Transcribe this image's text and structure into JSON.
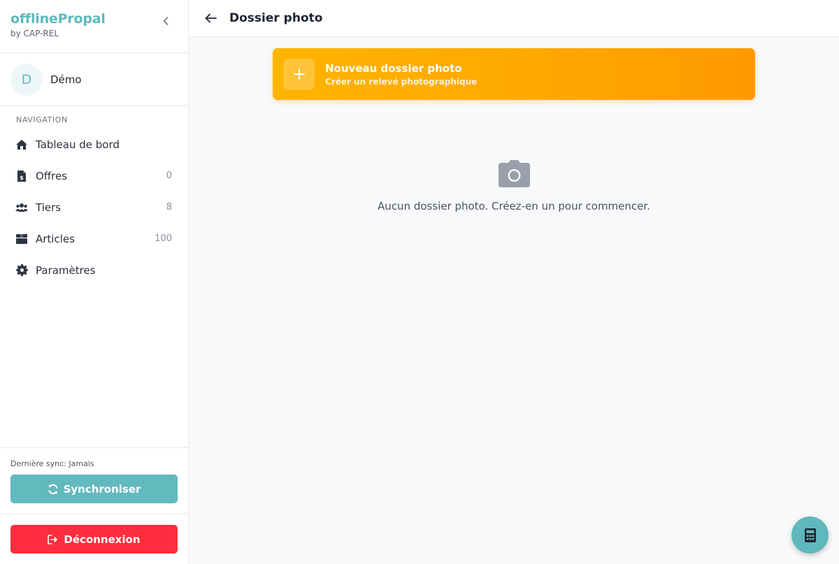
{
  "app": {
    "name": "offlinePropal",
    "subtitle": "by CAP-REL"
  },
  "user": {
    "initial": "D",
    "name": "Démo"
  },
  "navigation": {
    "title": "NAVIGATION",
    "items": [
      {
        "label": "Tableau de bord",
        "count": "",
        "icon": "home-icon"
      },
      {
        "label": "Offres",
        "count": "0",
        "icon": "invoice-icon"
      },
      {
        "label": "Tiers",
        "count": "8",
        "icon": "users-icon"
      },
      {
        "label": "Articles",
        "count": "100",
        "icon": "box-icon"
      },
      {
        "label": "Paramètres",
        "count": "",
        "icon": "gear-icon"
      }
    ]
  },
  "sync": {
    "last_sync": "Dernière sync: Jamais",
    "button_label": "Synchroniser"
  },
  "logout": {
    "button_label": "Déconnexion"
  },
  "header": {
    "title": "Dossier photo"
  },
  "new_folder": {
    "title": "Nouveau dossier photo",
    "subtitle": "Créer un relevé photographique"
  },
  "empty_state": {
    "message": "Aucun dossier photo. Créez-en un pour commencer.",
    "icon": "camera-icon"
  },
  "fab": {
    "icon": "calculator-icon"
  },
  "colors": {
    "brand": "#5fb8bd",
    "accent_orange": "#ffa800",
    "danger": "#ff2d3d"
  }
}
